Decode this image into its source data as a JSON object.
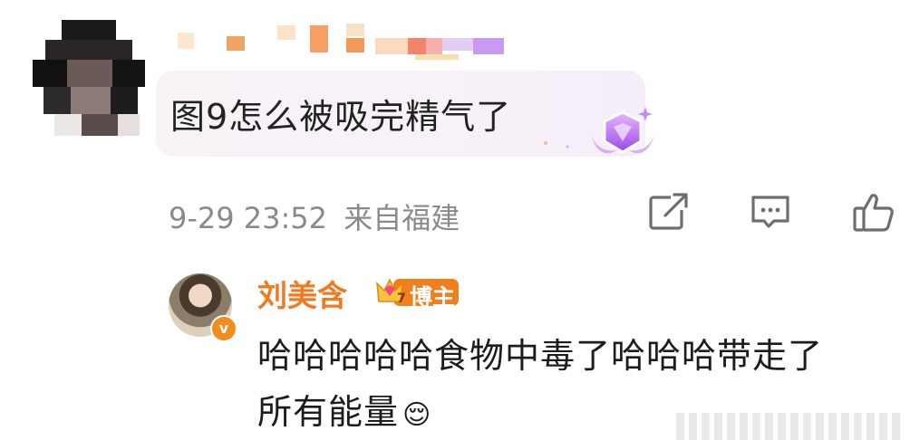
{
  "comment": {
    "text": "图9怎么被吸完精气了",
    "timestamp": "9-29 23:52",
    "location": "来自福建"
  },
  "actions": {
    "share_icon": "share-icon",
    "comment_icon": "comment-icon",
    "like_icon": "like-icon"
  },
  "reply": {
    "author": "刘美含",
    "badge_label": "博主",
    "badge_level": "7",
    "verified_mark": "v",
    "line1": "哈哈哈哈哈食物中毒了哈哈哈带走了",
    "line2": "所有能量",
    "emoji": "😌"
  },
  "colors": {
    "author_orange": "#f07a1f",
    "meta_gray": "#8a8a8a",
    "badge_orange": "#f0801d"
  }
}
